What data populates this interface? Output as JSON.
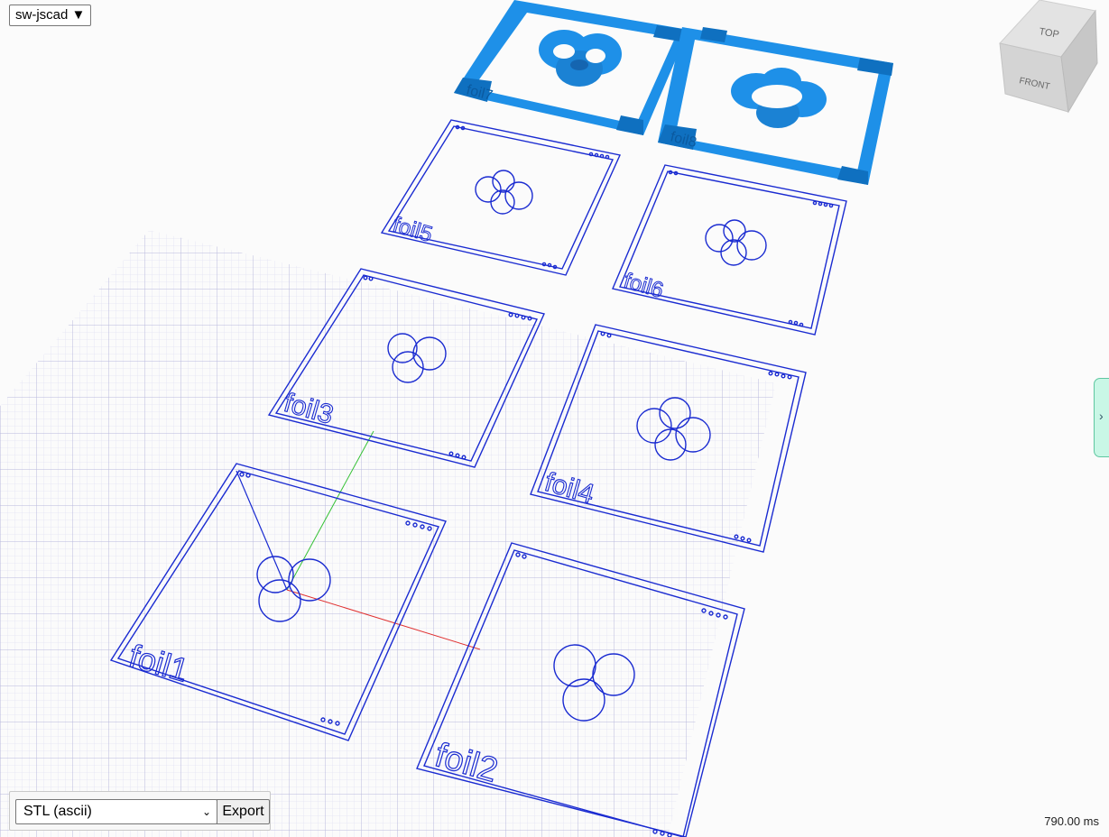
{
  "app_menu": {
    "label": "sw-jscad ▼"
  },
  "export": {
    "format": "STL (ascii)",
    "button_label": "Export"
  },
  "render_time": "790.00 ms",
  "nav_cube": {
    "top": "TOP",
    "front": "FRONT"
  },
  "side_panel_toggle": {
    "glyph": "›"
  },
  "foils": [
    {
      "label": "foil1"
    },
    {
      "label": "foil2"
    },
    {
      "label": "foil3"
    },
    {
      "label": "foil4"
    },
    {
      "label": "foil5"
    },
    {
      "label": "foil6"
    },
    {
      "label": "foil7"
    },
    {
      "label": "foil8"
    }
  ],
  "colors": {
    "outline": "#1a2bd1",
    "solid": "#1e90e8",
    "grid_minor": "#d6d6ee",
    "grid_major": "#a8a8d6",
    "axis_x": "#e03030",
    "axis_y": "#30c030",
    "side_tab": "#c9f7e6"
  }
}
